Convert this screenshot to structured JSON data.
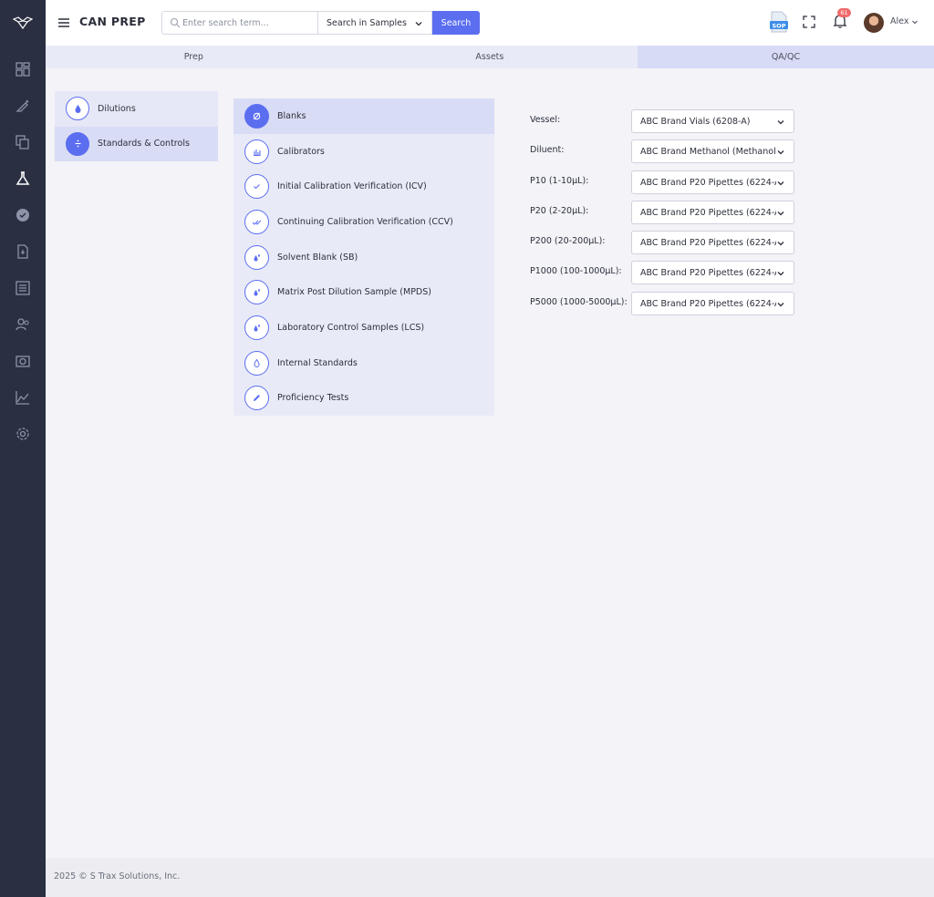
{
  "app": {
    "title": "CAN PREP"
  },
  "search": {
    "placeholder": "Enter search term...",
    "scope_selected": "Search in Samples",
    "button_label": "Search"
  },
  "header": {
    "notifications_count": "61",
    "user_name": "Alex",
    "sop_label": "SOP"
  },
  "tabs": [
    {
      "label": "Prep",
      "active": false
    },
    {
      "label": "Assets",
      "active": false
    },
    {
      "label": "QA/QC",
      "active": true
    }
  ],
  "leftnav": [
    {
      "label": "Dilutions",
      "icon": "drop-icon",
      "active": false
    },
    {
      "label": "Standards & Controls",
      "icon": "divide-icon",
      "active": true
    }
  ],
  "midlist": [
    {
      "label": "Blanks",
      "icon": "empty-set-icon",
      "active": true
    },
    {
      "label": "Calibrators",
      "icon": "bar-chart-icon",
      "active": false
    },
    {
      "label": "Initial Calibration Verification (ICV)",
      "icon": "check-icon",
      "active": false
    },
    {
      "label": "Continuing Calibration Verification (CCV)",
      "icon": "double-check-icon",
      "active": false
    },
    {
      "label": "Solvent Blank (SB)",
      "icon": "drops-icon",
      "active": false
    },
    {
      "label": "Matrix Post Dilution Sample (MPDS)",
      "icon": "drops-icon",
      "active": false
    },
    {
      "label": "Laboratory Control Samples (LCS)",
      "icon": "drops-icon",
      "active": false
    },
    {
      "label": "Internal Standards",
      "icon": "drop-outline-icon",
      "active": false
    },
    {
      "label": "Proficiency Tests",
      "icon": "pencil-icon",
      "active": false
    }
  ],
  "form": [
    {
      "label": "Vessel:",
      "value": "ABC Brand Vials (6208-A)"
    },
    {
      "label": "Diluent:",
      "value": "ABC Brand Methanol (Methanol-"
    },
    {
      "label": "P10 (1-10μL):",
      "value": "ABC Brand P20 Pipettes (6224-A"
    },
    {
      "label": "P20 (2-20μL):",
      "value": "ABC Brand P20 Pipettes (6224-A"
    },
    {
      "label": "P200 (20-200μL):",
      "value": "ABC Brand P20 Pipettes (6224-A"
    },
    {
      "label": "P1000 (100-1000μL):",
      "value": "ABC Brand P20 Pipettes (6224-A"
    },
    {
      "label": "P5000 (1000-5000μL):",
      "value": "ABC Brand P20 Pipettes (6224-A"
    }
  ],
  "footer": {
    "copyright": "2025 © S Trax Solutions, Inc."
  },
  "colors": {
    "sidebar": "#2a2f42",
    "accent": "#5b6ef0",
    "active_bg": "#d9dcf5",
    "panel_bg": "#e9eaf8"
  }
}
